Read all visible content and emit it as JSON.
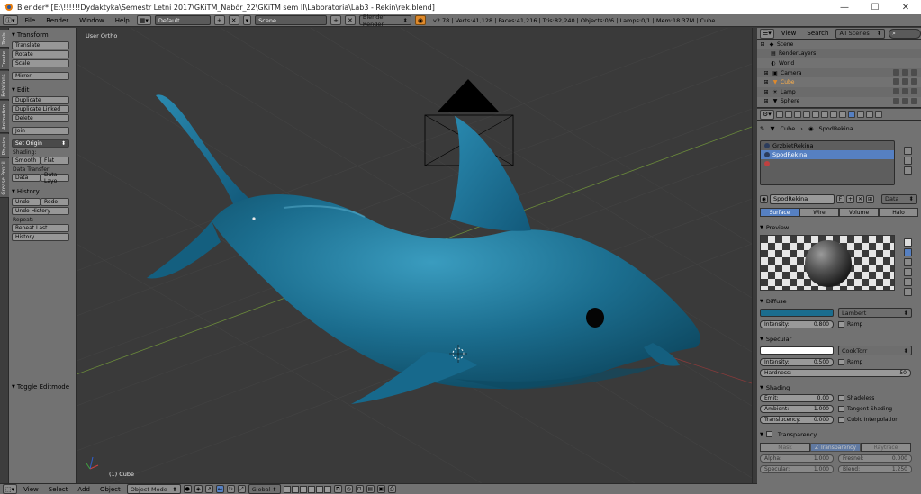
{
  "window": {
    "title": "Blender* [E:\\!!!!!!Dydaktyka\\Semestr Letni 2017\\GKiTM_Nabór_22\\GKiTM sem II\\Laboratoria\\Lab3 - Rekin\\rek.blend]",
    "minimize": "—",
    "maximize": "☐",
    "close": "✕"
  },
  "info_header": {
    "menus": [
      "File",
      "Render",
      "Window",
      "Help"
    ],
    "screen_layout": "Default",
    "scene": "Scene",
    "render_engine": "Blender Render",
    "stats": "v2.78 | Verts:41,128 | Faces:41,216 | Tris:82,240 | Objects:0/6 | Lamps:0/1 | Mem:18.37M | Cube"
  },
  "tool_tabs": [
    "Tools",
    "Create",
    "Relations",
    "Animation",
    "Physics",
    "Grease Pencil"
  ],
  "toolshelf": {
    "transform": {
      "header": "Transform",
      "buttons": [
        "Translate",
        "Rotate",
        "Scale",
        "Mirror"
      ]
    },
    "edit": {
      "header": "Edit",
      "buttons": [
        "Duplicate",
        "Duplicate Linked",
        "Delete",
        "Join"
      ],
      "set_origin": "Set Origin"
    },
    "shading": {
      "label": "Shading:",
      "smooth": "Smooth",
      "flat": "Flat"
    },
    "data_transfer": {
      "label": "Data Transfer:",
      "data": "Data",
      "data_layout": "Data Layo"
    },
    "history": {
      "header": "History",
      "undo": "Undo",
      "redo": "Redo",
      "undo_history": "Undo History",
      "repeat_label": "Repeat:",
      "repeat_last": "Repeat Last",
      "history_btn": "History..."
    }
  },
  "operator_panel": {
    "toggle": "Toggle Editmode"
  },
  "viewport": {
    "view_label": "User Ortho",
    "object_label": "(1) Cube"
  },
  "bottom_header": {
    "menus": [
      "View",
      "Select",
      "Add",
      "Object"
    ],
    "mode": "Object Mode",
    "orientation": "Global"
  },
  "outliner": {
    "menus": [
      "View",
      "Search"
    ],
    "filter": "All Scenes",
    "rows": [
      "Scene",
      "RenderLayers",
      "World",
      "Camera",
      "Cube",
      "Lamp",
      "Sphere"
    ]
  },
  "properties": {
    "breadcrumb": {
      "object": "Cube",
      "material": "SpodRekina"
    },
    "slots": [
      "GrzbietRekina",
      "SpodRekina",
      ""
    ],
    "material_name": "SpodRekina",
    "link_type": "Data",
    "tabs": [
      "Surface",
      "Wire",
      "Volume",
      "Halo"
    ],
    "preview": {
      "header": "Preview"
    },
    "diffuse": {
      "header": "Diffuse",
      "shader": "Lambert",
      "intensity_label": "Intensity:",
      "intensity": "0.800",
      "ramp": "Ramp"
    },
    "specular": {
      "header": "Specular",
      "shader": "CookTorr",
      "intensity_label": "Intensity:",
      "intensity": "0.500",
      "ramp": "Ramp",
      "hardness_label": "Hardness:",
      "hardness": "50"
    },
    "shading": {
      "header": "Shading",
      "emit_label": "Emit:",
      "emit": "0.00",
      "ambient_label": "Ambient:",
      "ambient": "1.000",
      "translucency_label": "Translucency:",
      "translucency": "0.000",
      "shadeless": "Shadeless",
      "tangent": "Tangent Shading",
      "cubic": "Cubic Interpolation"
    },
    "transparency": {
      "header": "Transparency",
      "modes": [
        "Mask",
        "Z Transparency",
        "Raytrace"
      ],
      "alpha_label": "Alpha:",
      "alpha": "1.000",
      "fresnel_label": "Fresnel:",
      "fresnel": "0.000",
      "specular_label": "Specular:",
      "specular": "1.000",
      "blend_label": "Blend:",
      "blend": "1.250"
    }
  },
  "colors": {
    "accent": "#5680c2",
    "shark": "#1b6d8e",
    "header_bg": "#727272",
    "viewport_bg": "#3a3a3a"
  }
}
